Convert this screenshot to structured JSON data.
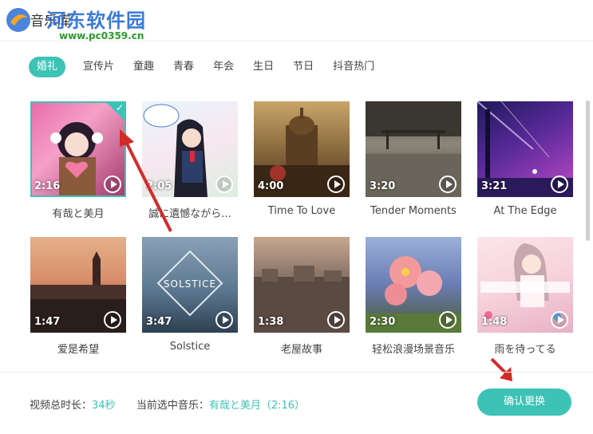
{
  "header": {
    "title": "音乐库",
    "watermark_title": "河东软件园",
    "watermark_url": "www.pc0359.cn"
  },
  "tabs": [
    {
      "label": "婚礼",
      "active": true
    },
    {
      "label": "宣传片",
      "active": false
    },
    {
      "label": "童趣",
      "active": false
    },
    {
      "label": "青春",
      "active": false
    },
    {
      "label": "年会",
      "active": false
    },
    {
      "label": "生日",
      "active": false
    },
    {
      "label": "节日",
      "active": false
    },
    {
      "label": "抖音热门",
      "active": false
    }
  ],
  "tracks": [
    {
      "name": "有哉と美月",
      "duration": "2:16",
      "selected": true
    },
    {
      "name": "誠に遺憾ながら...",
      "duration": "2:05",
      "selected": false
    },
    {
      "name": "Time To Love",
      "duration": "4:00",
      "selected": false
    },
    {
      "name": "Tender Moments",
      "duration": "3:20",
      "selected": false
    },
    {
      "name": "At The Edge",
      "duration": "3:21",
      "selected": false
    },
    {
      "name": "爱是希望",
      "duration": "1:47",
      "selected": false
    },
    {
      "name": "Solstice",
      "duration": "3:47",
      "selected": false
    },
    {
      "name": "老屋故事",
      "duration": "1:38",
      "selected": false
    },
    {
      "name": "轻松浪漫场景音乐",
      "duration": "2:30",
      "selected": false
    },
    {
      "name": "雨を待ってる",
      "duration": "1:48",
      "selected": false
    }
  ],
  "footer": {
    "total_label": "视频总时长：",
    "total_value": "34秒",
    "current_label": "当前选中音乐：",
    "current_value": "有哉と美月（2:16）",
    "confirm_label": "确认更换"
  },
  "colors": {
    "accent": "#3dc3b6",
    "annotation_arrow": "#d42a2a"
  }
}
